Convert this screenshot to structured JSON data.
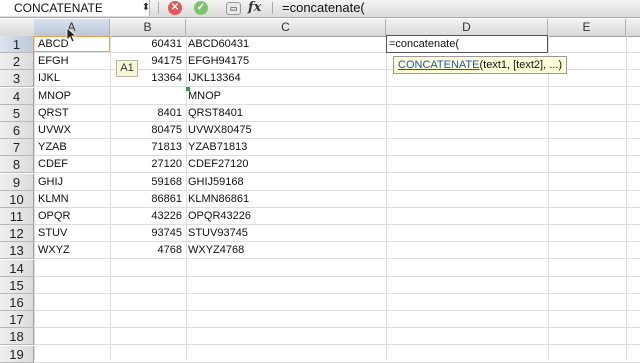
{
  "formula_bar": {
    "name_box": "CONCATENATE",
    "name_box_arrow": "⬍",
    "cancel_glyph": "✕",
    "enter_glyph": "✓",
    "insert_fn_glyph": "▭",
    "fx_label": "fx",
    "content": "=concatenate("
  },
  "columns": [
    "A",
    "B",
    "C",
    "D",
    "E"
  ],
  "rows": [
    {
      "n": "1",
      "a": "ABCD",
      "b": "60431",
      "c": "ABCD60431"
    },
    {
      "n": "2",
      "a": "EFGH",
      "b": "94175",
      "c": "EFGH94175"
    },
    {
      "n": "3",
      "a": "IJKL",
      "b": "13364",
      "c": "IJKL13364"
    },
    {
      "n": "4",
      "a": "MNOP",
      "b": "",
      "c": "MNOP"
    },
    {
      "n": "5",
      "a": "QRST",
      "b": "8401",
      "c": "QRST8401"
    },
    {
      "n": "6",
      "a": "UVWX",
      "b": "80475",
      "c": "UVWX80475"
    },
    {
      "n": "7",
      "a": "YZAB",
      "b": "71813",
      "c": "YZAB71813"
    },
    {
      "n": "8",
      "a": "CDEF",
      "b": "27120",
      "c": "CDEF27120"
    },
    {
      "n": "9",
      "a": "GHIJ",
      "b": "59168",
      "c": "GHIJ59168"
    },
    {
      "n": "10",
      "a": "KLMN",
      "b": "86861",
      "c": "KLMN86861"
    },
    {
      "n": "11",
      "a": "OPQR",
      "b": "43226",
      "c": "OPQR43226"
    },
    {
      "n": "12",
      "a": "STUV",
      "b": "93745",
      "c": "STUV93745"
    },
    {
      "n": "13",
      "a": "WXYZ",
      "b": "4768",
      "c": "WXYZ4768"
    },
    {
      "n": "14",
      "a": "",
      "b": "",
      "c": ""
    },
    {
      "n": "15",
      "a": "",
      "b": "",
      "c": ""
    },
    {
      "n": "16",
      "a": "",
      "b": "",
      "c": ""
    },
    {
      "n": "17",
      "a": "",
      "b": "",
      "c": ""
    },
    {
      "n": "18",
      "a": "",
      "b": "",
      "c": ""
    },
    {
      "n": "19",
      "a": "",
      "b": "",
      "c": ""
    }
  ],
  "editing_cell": {
    "text": "=concatenate("
  },
  "tooltip": {
    "function_name": "CONCATENATE",
    "args": "(text1, [text2], ...)"
  },
  "reference_badge": "A1",
  "colors": {
    "selection": "#f0a04b",
    "tooltip_bg": "#ffffd8",
    "link": "#1a4fcf"
  }
}
